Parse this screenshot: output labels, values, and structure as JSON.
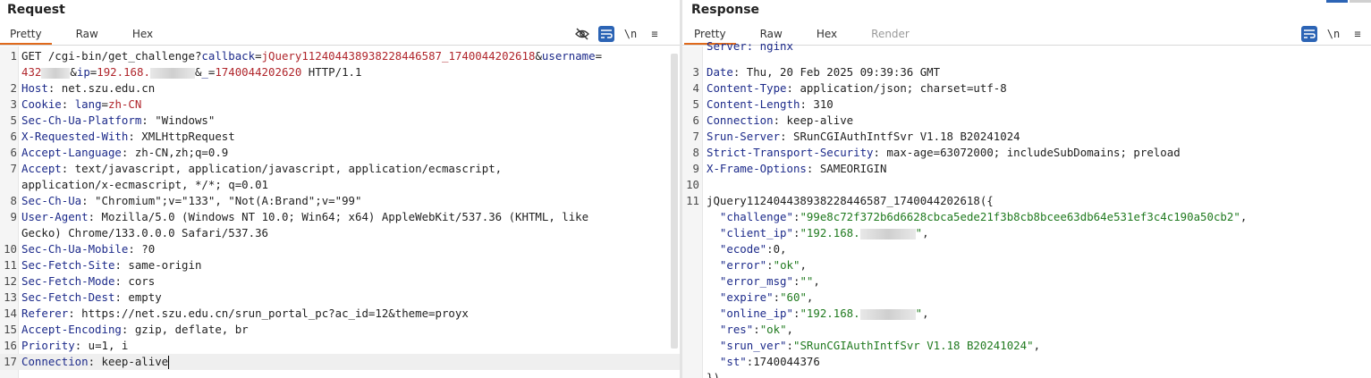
{
  "request": {
    "title": "Request",
    "tabs": [
      "Pretty",
      "Raw",
      "Hex"
    ],
    "active_tab": "Pretty",
    "tools": {
      "hide": "hide-icon",
      "wrap": "wrap-icon",
      "newline": "\\n",
      "menu": "≡"
    },
    "lines": [
      {
        "n": "1",
        "parts": [
          {
            "t": "GET /cgi-bin/get_challenge?",
            "c": ""
          },
          {
            "t": "callback",
            "c": "k"
          },
          {
            "t": "=",
            "c": ""
          },
          {
            "t": "jQuery112404438938228446587_1740044202618",
            "c": "r"
          },
          {
            "t": "&",
            "c": ""
          },
          {
            "t": "username",
            "c": "k"
          },
          {
            "t": "=",
            "c": ""
          }
        ]
      },
      {
        "n": "",
        "parts": [
          {
            "t": "432",
            "c": "r"
          },
          {
            "t": "#blur",
            "c": ""
          },
          {
            "t": "&",
            "c": ""
          },
          {
            "t": "ip",
            "c": "k"
          },
          {
            "t": "=",
            "c": ""
          },
          {
            "t": "192.168.",
            "c": "r"
          },
          {
            "t": "#blur50",
            "c": ""
          },
          {
            "t": "&",
            "c": ""
          },
          {
            "t": "_",
            "c": "k"
          },
          {
            "t": "=",
            "c": ""
          },
          {
            "t": "1740044202620",
            "c": "r"
          },
          {
            "t": " HTTP/1.1",
            "c": ""
          }
        ]
      },
      {
        "n": "2",
        "parts": [
          {
            "t": "Host",
            "c": "k"
          },
          {
            "t": ": net.szu.edu.cn",
            "c": ""
          }
        ]
      },
      {
        "n": "3",
        "parts": [
          {
            "t": "Cookie",
            "c": "k"
          },
          {
            "t": ": ",
            "c": ""
          },
          {
            "t": "lang",
            "c": "k"
          },
          {
            "t": "=",
            "c": ""
          },
          {
            "t": "zh-CN",
            "c": "r"
          }
        ]
      },
      {
        "n": "5",
        "parts": [
          {
            "t": "Sec-Ch-Ua-Platform",
            "c": "k"
          },
          {
            "t": ": \"Windows\"",
            "c": ""
          }
        ]
      },
      {
        "n": "6",
        "parts": [
          {
            "t": "X-Requested-With",
            "c": "k"
          },
          {
            "t": ": XMLHttpRequest",
            "c": ""
          }
        ]
      },
      {
        "n": "6",
        "parts": [
          {
            "t": "Accept-Language",
            "c": "k"
          },
          {
            "t": ": zh-CN,zh;q=0.9",
            "c": ""
          }
        ]
      },
      {
        "n": "7",
        "parts": [
          {
            "t": "Accept",
            "c": "k"
          },
          {
            "t": ": text/javascript, application/javascript, application/ecmascript,",
            "c": ""
          }
        ]
      },
      {
        "n": "",
        "parts": [
          {
            "t": "application/x-ecmascript, */*; q=0.01",
            "c": ""
          }
        ]
      },
      {
        "n": "8",
        "parts": [
          {
            "t": "Sec-Ch-Ua",
            "c": "k"
          },
          {
            "t": ": \"Chromium\";v=\"133\", \"Not(A:Brand\";v=\"99\"",
            "c": ""
          }
        ]
      },
      {
        "n": "9",
        "parts": [
          {
            "t": "User-Agent",
            "c": "k"
          },
          {
            "t": ": Mozilla/5.0 (Windows NT 10.0; Win64; x64) AppleWebKit/537.36 (KHTML, like",
            "c": ""
          }
        ]
      },
      {
        "n": "",
        "parts": [
          {
            "t": "Gecko) Chrome/133.0.0.0 Safari/537.36",
            "c": ""
          }
        ]
      },
      {
        "n": "10",
        "parts": [
          {
            "t": "Sec-Ch-Ua-Mobile",
            "c": "k"
          },
          {
            "t": ": ?0",
            "c": ""
          }
        ]
      },
      {
        "n": "11",
        "parts": [
          {
            "t": "Sec-Fetch-Site",
            "c": "k"
          },
          {
            "t": ": same-origin",
            "c": ""
          }
        ]
      },
      {
        "n": "12",
        "parts": [
          {
            "t": "Sec-Fetch-Mode",
            "c": "k"
          },
          {
            "t": ": cors",
            "c": ""
          }
        ]
      },
      {
        "n": "13",
        "parts": [
          {
            "t": "Sec-Fetch-Dest",
            "c": "k"
          },
          {
            "t": ": empty",
            "c": ""
          }
        ]
      },
      {
        "n": "14",
        "parts": [
          {
            "t": "Referer",
            "c": "k"
          },
          {
            "t": ": https://net.szu.edu.cn/srun_portal_pc?ac_id=12&theme=proyx",
            "c": ""
          }
        ]
      },
      {
        "n": "15",
        "parts": [
          {
            "t": "Accept-Encoding",
            "c": "k"
          },
          {
            "t": ": gzip, deflate, br",
            "c": ""
          }
        ]
      },
      {
        "n": "16",
        "parts": [
          {
            "t": "Priority",
            "c": "k"
          },
          {
            "t": ": u=1, i",
            "c": ""
          }
        ]
      },
      {
        "n": "17",
        "parts": [
          {
            "t": "Connection",
            "c": "k"
          },
          {
            "t": ": keep-alive",
            "c": ""
          },
          {
            "t": "#caret",
            "c": ""
          }
        ],
        "highlight": true
      }
    ]
  },
  "response": {
    "title": "Response",
    "tabs": [
      "Pretty",
      "Raw",
      "Hex",
      "Render"
    ],
    "active_tab": "Pretty",
    "tools": {
      "wrap": "wrap-icon",
      "newline": "\\n",
      "menu": "≡"
    },
    "lines": [
      {
        "n": "",
        "parts": [
          {
            "t": "Server: nginx",
            "c": "k"
          }
        ],
        "clipped": true
      },
      {
        "n": "3",
        "parts": [
          {
            "t": "Date",
            "c": "k"
          },
          {
            "t": ": Thu, 20 Feb 2025 09:39:36 GMT",
            "c": ""
          }
        ]
      },
      {
        "n": "4",
        "parts": [
          {
            "t": "Content-Type",
            "c": "k"
          },
          {
            "t": ": application/json; charset=utf-8",
            "c": ""
          }
        ]
      },
      {
        "n": "5",
        "parts": [
          {
            "t": "Content-Length",
            "c": "k"
          },
          {
            "t": ": 310",
            "c": ""
          }
        ]
      },
      {
        "n": "6",
        "parts": [
          {
            "t": "Connection",
            "c": "k"
          },
          {
            "t": ": keep-alive",
            "c": ""
          }
        ]
      },
      {
        "n": "7",
        "parts": [
          {
            "t": "Srun-Server",
            "c": "k"
          },
          {
            "t": ": SRunCGIAuthIntfSvr V1.18 B20241024",
            "c": ""
          }
        ]
      },
      {
        "n": "8",
        "parts": [
          {
            "t": "Strict-Transport-Security",
            "c": "k"
          },
          {
            "t": ": max-age=63072000; includeSubDomains; preload",
            "c": ""
          }
        ]
      },
      {
        "n": "9",
        "parts": [
          {
            "t": "X-Frame-Options",
            "c": "k"
          },
          {
            "t": ": SAMEORIGIN",
            "c": ""
          }
        ]
      },
      {
        "n": "10",
        "parts": []
      },
      {
        "n": "11",
        "parts": [
          {
            "t": "jQuery112404438938228446587_1740044202618({",
            "c": ""
          }
        ]
      },
      {
        "n": "",
        "parts": [
          {
            "t": "  \"challenge\"",
            "c": "k"
          },
          {
            "t": ":",
            "c": ""
          },
          {
            "t": "\"99e8c72f372b6d6628cbca5ede21f3b8cb8bcee63db64e531ef3c4c190a50cb2\"",
            "c": "g"
          },
          {
            "t": ",",
            "c": ""
          }
        ]
      },
      {
        "n": "",
        "parts": [
          {
            "t": "  \"client_ip\"",
            "c": "k"
          },
          {
            "t": ":",
            "c": ""
          },
          {
            "t": "\"192.168.",
            "c": "g"
          },
          {
            "t": "#blur60",
            "c": ""
          },
          {
            "t": "\"",
            "c": "g"
          },
          {
            "t": ",",
            "c": ""
          }
        ]
      },
      {
        "n": "",
        "parts": [
          {
            "t": "  \"ecode\"",
            "c": "k"
          },
          {
            "t": ":0,",
            "c": ""
          }
        ]
      },
      {
        "n": "",
        "parts": [
          {
            "t": "  \"error\"",
            "c": "k"
          },
          {
            "t": ":",
            "c": ""
          },
          {
            "t": "\"ok\"",
            "c": "g"
          },
          {
            "t": ",",
            "c": ""
          }
        ]
      },
      {
        "n": "",
        "parts": [
          {
            "t": "  \"error_msg\"",
            "c": "k"
          },
          {
            "t": ":",
            "c": ""
          },
          {
            "t": "\"\"",
            "c": "g"
          },
          {
            "t": ",",
            "c": ""
          }
        ]
      },
      {
        "n": "",
        "parts": [
          {
            "t": "  \"expire\"",
            "c": "k"
          },
          {
            "t": ":",
            "c": ""
          },
          {
            "t": "\"60\"",
            "c": "g"
          },
          {
            "t": ",",
            "c": ""
          }
        ]
      },
      {
        "n": "",
        "parts": [
          {
            "t": "  \"online_ip\"",
            "c": "k"
          },
          {
            "t": ":",
            "c": ""
          },
          {
            "t": "\"192.168.",
            "c": "g"
          },
          {
            "t": "#blur60",
            "c": ""
          },
          {
            "t": "\"",
            "c": "g"
          },
          {
            "t": ",",
            "c": ""
          }
        ]
      },
      {
        "n": "",
        "parts": [
          {
            "t": "  \"res\"",
            "c": "k"
          },
          {
            "t": ":",
            "c": ""
          },
          {
            "t": "\"ok\"",
            "c": "g"
          },
          {
            "t": ",",
            "c": ""
          }
        ]
      },
      {
        "n": "",
        "parts": [
          {
            "t": "  \"srun_ver\"",
            "c": "k"
          },
          {
            "t": ":",
            "c": ""
          },
          {
            "t": "\"SRunCGIAuthIntfSvr V1.18 B20241024\"",
            "c": "g"
          },
          {
            "t": ",",
            "c": ""
          }
        ]
      },
      {
        "n": "",
        "parts": [
          {
            "t": "  \"st\"",
            "c": "k"
          },
          {
            "t": ":1740044376",
            "c": ""
          }
        ]
      },
      {
        "n": "",
        "parts": [
          {
            "t": "})",
            "c": ""
          }
        ]
      }
    ]
  },
  "colors": {
    "accent": "#e06a1c",
    "selected_tool": "#2c64b5",
    "header_key": "#1c2a8a",
    "param_value": "#b0262c",
    "json_string": "#207a1f"
  }
}
